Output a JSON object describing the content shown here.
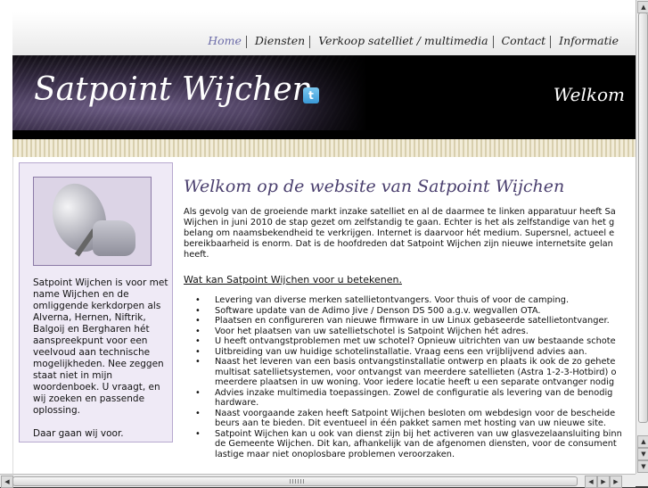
{
  "nav": {
    "items": [
      "Home",
      "Diensten",
      "Verkoop satelliet / multimedia",
      "Contact",
      "Informatie"
    ]
  },
  "banner": {
    "title": "Satpoint Wijchen",
    "welkom": "Welkom",
    "twitter_icon": "t"
  },
  "sidebar": {
    "text1": "Satpoint Wijchen is voor met name Wijchen en de omliggende kerkdorpen als Alverna, Hernen, Niftrik, Balgoij en Bergharen hét aanspreekpunt voor een veelvoud aan technische mogelijkheden. Nee zeggen staat niet in mijn woordenboek. U vraagt, en wij zoeken en passende oplossing.",
    "text2": "Daar gaan wij voor."
  },
  "main": {
    "heading": "Welkom op de website van Satpoint Wijchen",
    "intro": [
      "Als gevolg van de groeiende markt inzake satelliet en al de daarmee te linken apparatuur heeft Sa",
      "Wijchen in juni 2010 de stap gezet om zelfstandig te gaan. Echter is het als zelfstandige van het g",
      "belang om naamsbekendheid te verkrijgen. Internet is daarvoor hét medium. Supersnel, actueel e",
      "bereikbaarheid is enorm. Dat is de hoofdreden dat Satpoint Wijchen zijn nieuwe internetsite gelan",
      "heeft."
    ],
    "subheading": "Wat kan Satpoint Wijchen voor u betekenen.",
    "bullets": [
      [
        "Levering van diverse merken satellietontvangers. Voor thuis of voor de camping."
      ],
      [
        "Software update van de Adimo Jive / Denson DS 500 a.g.v. wegvallen OTA."
      ],
      [
        "Plaatsen en configureren van nieuwe firmware in uw Linux gebaseerde satellietontvanger."
      ],
      [
        "Voor het plaatsen van uw satellietschotel is Satpoint Wijchen hét adres."
      ],
      [
        "U heeft ontvangstproblemen met uw schotel? Opnieuw uitrichten van uw bestaande schote"
      ],
      [
        "Uitbreiding van uw huidige schotelinstallatie. Vraag eens een vrijblijvend advies aan."
      ],
      [
        "Naast het leveren van een basis ontvangstinstallatie ontwerp en plaats ik ook de zo gehete",
        "multisat satellietsystemen, voor ontvangst van meerdere satellieten (Astra 1-2-3-Hotbird) o",
        "meerdere plaatsen in uw woning. Voor iedere locatie heeft u een separate ontvanger nodig"
      ],
      [
        "Advies inzake multimedia toepassingen. Zowel de configuratie als levering van de benodig",
        "hardware."
      ],
      [
        "Naast voorgaande zaken heeft Satpoint Wijchen besloten om webdesign voor de bescheide",
        "beurs aan te bieden. Dit eventueel in één pakket samen met hosting van uw nieuwe site."
      ],
      [
        "Satpoint Wijchen kan u ook van dienst zijn bij het activeren van uw glasvezelaansluiting binn",
        "de Gemeente Wijchen. Dit kan, afhankelijk van de afgenomen diensten, voor de consument",
        "lastige maar niet onoplosbare problemen veroorzaken."
      ]
    ]
  }
}
